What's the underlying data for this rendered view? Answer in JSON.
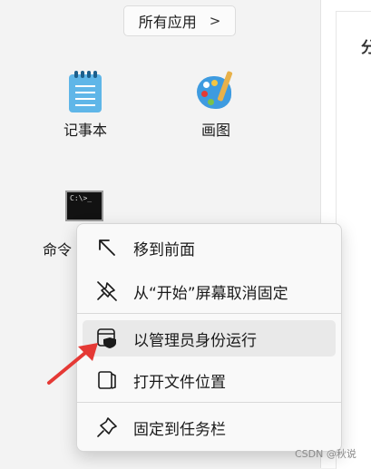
{
  "start_menu": {
    "all_apps_label": "所有应用",
    "all_apps_chevron": ">",
    "apps": [
      {
        "label": "记事本",
        "icon": "notepad-icon"
      },
      {
        "label": "画图",
        "icon": "paint-icon"
      }
    ],
    "cmd_icon_text": "C:\\>_",
    "cmd_label_partial": "命令"
  },
  "context_menu": {
    "items": [
      {
        "label": "移到前面",
        "icon": "arrow-up-left-icon"
      },
      {
        "label": "从“开始”屏幕取消固定",
        "icon": "unpin-icon"
      },
      {
        "label": "以管理员身份运行",
        "icon": "shield-window-icon",
        "highlighted": true
      },
      {
        "label": "打开文件位置",
        "icon": "folder-icon"
      },
      {
        "label": "固定到任务栏",
        "icon": "pin-icon"
      }
    ]
  },
  "right_panel": {
    "glyph": "分"
  },
  "annotation": {
    "arrow_color": "#e53935"
  },
  "watermark": "CSDN @秋说"
}
